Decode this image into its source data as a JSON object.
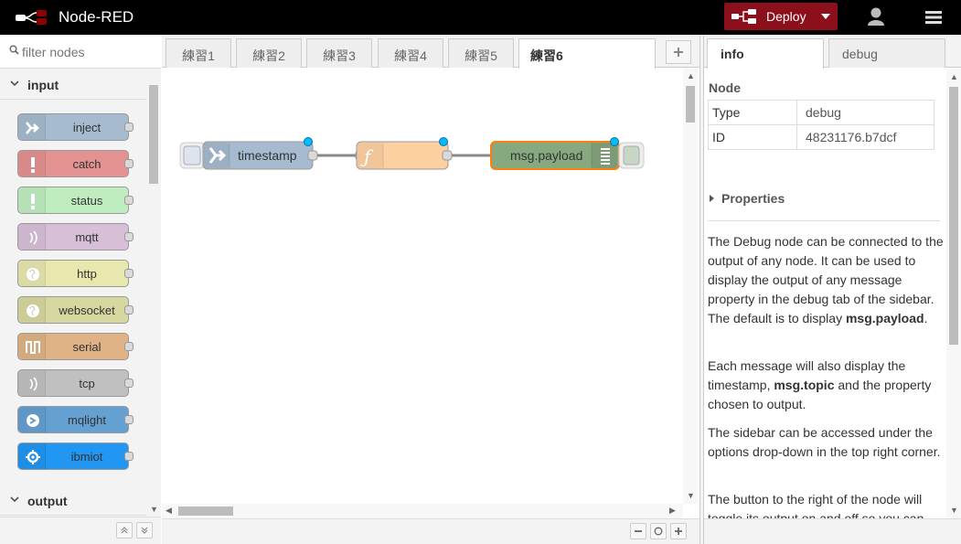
{
  "header": {
    "title": "Node-RED",
    "deploy_label": "Deploy"
  },
  "palette": {
    "search_placeholder": "filter nodes",
    "categories": [
      {
        "label": "input"
      },
      {
        "label": "output"
      }
    ],
    "nodes": [
      {
        "label": "inject",
        "color": "#a6bbcf",
        "icon": "inject-arrow-icon"
      },
      {
        "label": "catch",
        "color": "#e49191",
        "icon": "alert-icon"
      },
      {
        "label": "status",
        "color": "#c0edc0",
        "icon": "alert-icon"
      },
      {
        "label": "mqtt",
        "color": "#d8bfd8",
        "icon": "bridge-icon"
      },
      {
        "label": "http",
        "color": "#e7e7ae",
        "icon": "white-globe-icon"
      },
      {
        "label": "websocket",
        "color": "#d7d7a0",
        "icon": "white-globe-icon"
      },
      {
        "label": "serial",
        "color": "#dfb385",
        "icon": "serial-icon"
      },
      {
        "label": "tcp",
        "color": "#c0c0c0",
        "icon": "bridge-icon"
      },
      {
        "label": "mqlight",
        "color": "#65a0d2",
        "icon": "mqlight-icon"
      },
      {
        "label": "ibmiot",
        "color": "#2196f3",
        "icon": "gear-icon"
      }
    ]
  },
  "workspace": {
    "tabs": [
      {
        "label": "練習1"
      },
      {
        "label": "練習2"
      },
      {
        "label": "練習3"
      },
      {
        "label": "練習4"
      },
      {
        "label": "練習5"
      },
      {
        "label": "練習6",
        "active": true
      }
    ],
    "flow_nodes": [
      {
        "label": "timestamp",
        "color": "#a6bbcf",
        "icon": "inject-arrow-icon"
      },
      {
        "label": "",
        "color": "#fdd0a2",
        "icon": "function-icon"
      },
      {
        "label": "msg.payload",
        "color": "#87a980",
        "icon": "debug-list-icon",
        "selected": true
      }
    ]
  },
  "sidebar": {
    "tabs": [
      {
        "label": "info",
        "active": true
      },
      {
        "label": "debug"
      }
    ],
    "node_title": "Node",
    "rows": [
      {
        "key": "Type",
        "value": "debug"
      },
      {
        "key": "ID",
        "value": "48231176.b7dcf"
      }
    ],
    "properties_label": "Properties",
    "help": [
      {
        "text_a": "The Debug node can be connected to the output of any node. It can be used to display the output of any message property in the debug tab of the sidebar. The default is to display ",
        "bold_a": "msg.payload",
        "text_b": ".",
        "bold_b": "",
        "text_c": ""
      },
      {
        "text_a": "Each message will also display the timestamp, ",
        "bold_a": "msg.topic",
        "text_b": " and the property chosen to output.",
        "bold_b": "",
        "text_c": ""
      },
      {
        "text_a": "The sidebar can be accessed under the options drop-down in the top right corner.",
        "bold_a": "",
        "text_b": "",
        "bold_b": "",
        "text_c": ""
      },
      {
        "text_a": "The button to the right of the node will toggle its output on and off so you can de-clutter the debug window.",
        "bold_a": "",
        "text_b": "",
        "bold_b": "",
        "text_c": ""
      }
    ]
  }
}
